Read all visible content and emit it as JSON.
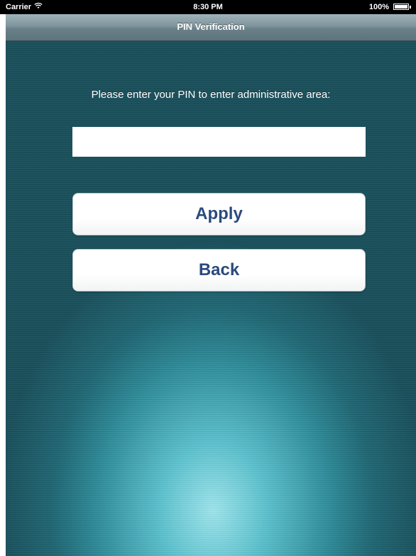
{
  "status_bar": {
    "carrier": "Carrier",
    "time": "8:30 PM",
    "battery": "100%"
  },
  "nav": {
    "title": "PIN Verification"
  },
  "form": {
    "prompt": "Please enter your PIN to enter administrative area:",
    "pin_value": "",
    "apply_label": "Apply",
    "back_label": "Back"
  },
  "colors": {
    "button_text": "#2a4a7c",
    "background_glow": "#9fe6ee",
    "background_dark": "#184f5b"
  }
}
